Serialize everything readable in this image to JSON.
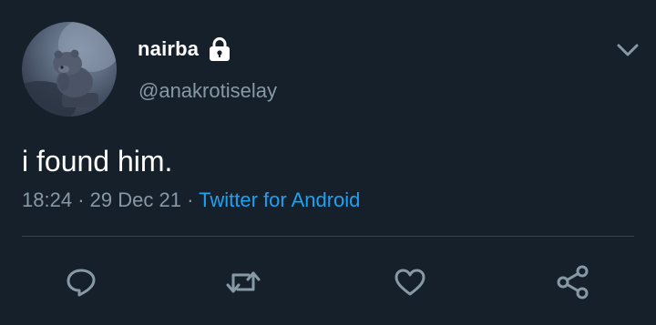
{
  "tweet": {
    "author": {
      "display_name": "nairba",
      "handle": "@anakrotiselay",
      "protected_icon": "lock-icon",
      "avatar": "avatar-image"
    },
    "menu_icon": "chevron-down-icon",
    "text": "i found him.",
    "time": "18:24",
    "separator": "·",
    "date": "29 Dec 21",
    "source": "Twitter for Android"
  },
  "actions": [
    {
      "name": "reply-icon"
    },
    {
      "name": "retweet-icon"
    },
    {
      "name": "like-icon"
    },
    {
      "name": "share-icon"
    }
  ],
  "colors": {
    "background": "#15202b",
    "primary_text": "#ffffff",
    "secondary_text": "#8899a6",
    "link": "#1da1f2",
    "divider": "#38444d"
  }
}
